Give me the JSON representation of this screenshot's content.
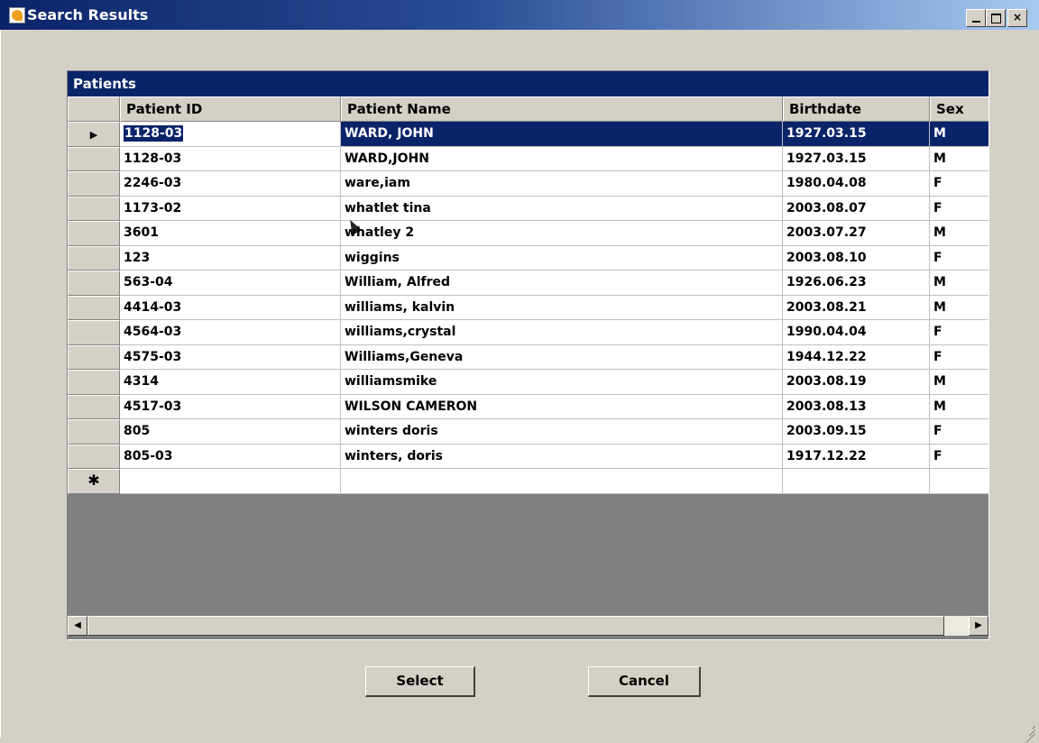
{
  "window": {
    "title": "Search Results",
    "controls": {
      "minimize": "_",
      "maximize": "□",
      "close": "×"
    }
  },
  "grid": {
    "caption": "Patients",
    "columns": [
      "Patient ID",
      "Patient Name",
      "Birthdate",
      "Sex"
    ],
    "selected_row": 0,
    "current_row_marker": "▶",
    "new_row_marker": "✱",
    "rows": [
      {
        "id": "1128-03",
        "name": "WARD, JOHN",
        "birthdate": "1927.03.15",
        "sex": "M"
      },
      {
        "id": "1128-03",
        "name": "WARD,JOHN",
        "birthdate": "1927.03.15",
        "sex": "M"
      },
      {
        "id": "2246-03",
        "name": "ware,iam",
        "birthdate": "1980.04.08",
        "sex": "F"
      },
      {
        "id": "1173-02",
        "name": "whatlet tina",
        "birthdate": "2003.08.07",
        "sex": "F"
      },
      {
        "id": "3601",
        "name": "whatley 2",
        "birthdate": "2003.07.27",
        "sex": "M"
      },
      {
        "id": "123",
        "name": "wiggins",
        "birthdate": "2003.08.10",
        "sex": "F"
      },
      {
        "id": "563-04",
        "name": "William, Alfred",
        "birthdate": "1926.06.23",
        "sex": "M"
      },
      {
        "id": "4414-03",
        "name": "williams, kalvin",
        "birthdate": "2003.08.21",
        "sex": "M"
      },
      {
        "id": "4564-03",
        "name": "williams,crystal",
        "birthdate": "1990.04.04",
        "sex": "F"
      },
      {
        "id": "4575-03",
        "name": "Williams,Geneva",
        "birthdate": "1944.12.22",
        "sex": "F"
      },
      {
        "id": "4314",
        "name": "williamsmike",
        "birthdate": "2003.08.19",
        "sex": "M"
      },
      {
        "id": "4517-03",
        "name": "WILSON CAMERON",
        "birthdate": "2003.08.13",
        "sex": "M"
      },
      {
        "id": "805",
        "name": "winters doris",
        "birthdate": "2003.09.15",
        "sex": "F"
      },
      {
        "id": "805-03",
        "name": "winters, doris",
        "birthdate": "1917.12.22",
        "sex": "F"
      }
    ]
  },
  "scrollbar": {
    "left_arrow": "◀",
    "right_arrow": "▶"
  },
  "buttons": {
    "select": "Select",
    "cancel": "Cancel"
  },
  "colors": {
    "selection": "#0a246a",
    "window_bg": "#d4d0c8",
    "grid_empty": "#808080"
  }
}
